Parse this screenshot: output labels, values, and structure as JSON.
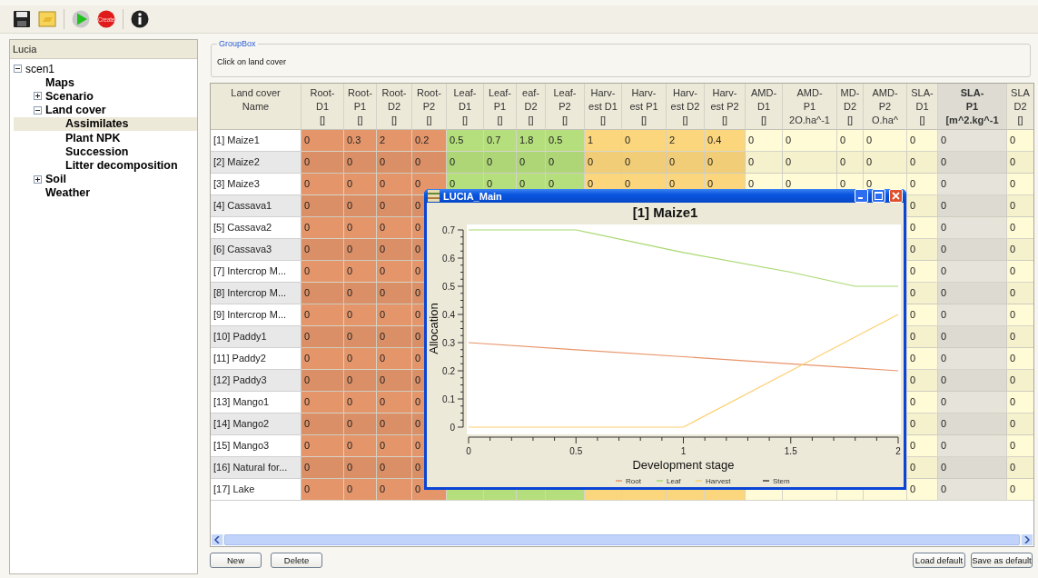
{
  "toolbar": {
    "buttons": [
      {
        "kind": "save"
      },
      {
        "kind": "open"
      },
      {
        "kind": "run"
      },
      {
        "kind": "stop",
        "label": "Create"
      },
      {
        "kind": "info"
      }
    ]
  },
  "tree": {
    "title": "Lucia",
    "items": [
      {
        "label": "scen1",
        "expanded": true,
        "selected": false,
        "children": [
          {
            "label": "Maps",
            "selected": false
          },
          {
            "label": "Scenario",
            "expanded": false,
            "selected": false
          },
          {
            "label": "Land cover",
            "expanded": true,
            "selected": false,
            "children": [
              {
                "label": "Assimilates",
                "selected": true
              },
              {
                "label": "Plant NPK",
                "selected": false
              },
              {
                "label": "Succession",
                "selected": false
              },
              {
                "label": "Litter decomposition",
                "selected": false
              }
            ]
          },
          {
            "label": "Soil",
            "expanded": false,
            "selected": false
          },
          {
            "label": "Weather",
            "selected": false
          }
        ]
      }
    ]
  },
  "groupbox": {
    "title": "GroupBox",
    "text": "Click on land cover"
  },
  "table": {
    "name_header": [
      "Land cover",
      "Name"
    ],
    "columns": [
      {
        "lines": [
          "Root-",
          "D1",
          "[]"
        ],
        "color": "#e4956a",
        "selected": false
      },
      {
        "lines": [
          "Root-",
          "P1",
          "[]"
        ],
        "color": "#e4956a",
        "selected": false
      },
      {
        "lines": [
          "Root-",
          "D2",
          "[]"
        ],
        "color": "#e4956a",
        "selected": false
      },
      {
        "lines": [
          "Root-",
          "P2",
          "[]"
        ],
        "color": "#e4956a",
        "selected": false
      },
      {
        "lines": [
          "Leaf-",
          "D1",
          "[]"
        ],
        "color": "#b5df7c",
        "selected": false
      },
      {
        "lines": [
          "Leaf-",
          "P1",
          "[]"
        ],
        "color": "#b5df7c",
        "selected": false
      },
      {
        "lines": [
          "eaf-",
          "D2",
          "[]"
        ],
        "color": "#b5df7c",
        "selected": false
      },
      {
        "lines": [
          "Leaf-",
          "P2",
          "[]"
        ],
        "color": "#b5df7c",
        "selected": false
      },
      {
        "lines": [
          "Harv-",
          "est D1",
          "[]"
        ],
        "color": "#fcd67c",
        "selected": false
      },
      {
        "lines": [
          "Harv-",
          "est P1",
          "[]"
        ],
        "color": "#fcd67c",
        "selected": false
      },
      {
        "lines": [
          "Harv-",
          "est D2",
          "[]"
        ],
        "color": "#fcd67c",
        "selected": false
      },
      {
        "lines": [
          "Harv-",
          "est P2",
          "[]"
        ],
        "color": "#fcd67c",
        "selected": false
      },
      {
        "lines": [
          "AMD-",
          "D1",
          "[]"
        ],
        "color": "#fffbd6",
        "selected": false
      },
      {
        "lines": [
          "AMD-",
          "P1",
          "2O.ha^-1"
        ],
        "color": "#fffbd6",
        "selected": false
      },
      {
        "lines": [
          "MD-",
          "D2",
          "[]"
        ],
        "color": "#fffbd6",
        "selected": false
      },
      {
        "lines": [
          "AMD-",
          "P2",
          "O.ha^"
        ],
        "color": "#fffbd6",
        "selected": false
      },
      {
        "lines": [
          "SLA-",
          "D1",
          "[]"
        ],
        "color": "#fffbd6",
        "selected": false
      },
      {
        "lines": [
          "SLA-",
          "P1",
          "[m^2.kg^-1"
        ],
        "color": "#e6e4da",
        "selected": true
      },
      {
        "lines": [
          "SLA",
          "D2",
          "[]"
        ],
        "color": "#fffbd6",
        "selected": false
      }
    ],
    "rows": [
      {
        "name": "[1] Maize1",
        "cells": [
          "0",
          "0.3",
          "2",
          "0.2",
          "0.5",
          "0.7",
          "1.8",
          "0.5",
          "1",
          "0",
          "2",
          "0.4",
          "0",
          "0",
          "0",
          "0",
          "0",
          "0",
          "0"
        ]
      },
      {
        "name": "[2] Maize2",
        "cells": [
          "0",
          "0",
          "0",
          "0",
          "0",
          "0",
          "0",
          "0",
          "0",
          "0",
          "0",
          "0",
          "0",
          "0",
          "0",
          "0",
          "0",
          "0",
          "0"
        ]
      },
      {
        "name": "[3] Maize3",
        "cells": [
          "0",
          "0",
          "0",
          "0",
          "0",
          "0",
          "0",
          "0",
          "0",
          "0",
          "0",
          "0",
          "0",
          "0",
          "0",
          "0",
          "0",
          "0",
          "0"
        ]
      },
      {
        "name": "[4] Cassava1",
        "cells": [
          "0",
          "0",
          "0",
          "0"
        ],
        "tail_cells": [
          "0",
          "0",
          "0"
        ]
      },
      {
        "name": "[5] Cassava2",
        "cells": [
          "0",
          "0",
          "0",
          "0"
        ],
        "tail_cells": [
          "0",
          "0",
          "0"
        ]
      },
      {
        "name": "[6] Cassava3",
        "cells": [
          "0",
          "0",
          "0",
          "0"
        ],
        "tail_cells": [
          "0",
          "0",
          "0"
        ]
      },
      {
        "name": "[7] Intercrop M...",
        "cells": [
          "0",
          "0",
          "0",
          "0"
        ],
        "tail_cells": [
          "0",
          "0",
          "0"
        ]
      },
      {
        "name": "[8] Intercrop M...",
        "cells": [
          "0",
          "0",
          "0",
          "0"
        ],
        "tail_cells": [
          "0",
          "0",
          "0"
        ]
      },
      {
        "name": "[9] Intercrop M...",
        "cells": [
          "0",
          "0",
          "0",
          "0"
        ],
        "tail_cells": [
          "0",
          "0",
          "0"
        ]
      },
      {
        "name": "[10] Paddy1",
        "cells": [
          "0",
          "0",
          "0",
          "0"
        ],
        "tail_cells": [
          "0",
          "0",
          "0"
        ]
      },
      {
        "name": "[11] Paddy2",
        "cells": [
          "0",
          "0",
          "0",
          "0"
        ],
        "tail_cells": [
          "0",
          "0",
          "0"
        ]
      },
      {
        "name": "[12] Paddy3",
        "cells": [
          "0",
          "0",
          "0",
          "0"
        ],
        "tail_cells": [
          "0",
          "0",
          "0"
        ]
      },
      {
        "name": "[13] Mango1",
        "cells": [
          "0",
          "0",
          "0",
          "0"
        ],
        "tail_cells": [
          "0",
          "0",
          "0"
        ]
      },
      {
        "name": "[14] Mango2",
        "cells": [
          "0",
          "0",
          "0",
          "0"
        ],
        "tail_cells": [
          "0",
          "0",
          "0"
        ]
      },
      {
        "name": "[15] Mango3",
        "cells": [
          "0",
          "0",
          "0",
          "0"
        ],
        "tail_cells": [
          "0",
          "0",
          "0"
        ]
      },
      {
        "name": "[16] Natural for...",
        "cells": [
          "0",
          "0",
          "0",
          "0"
        ],
        "tail_cells": [
          "0",
          "0",
          "0"
        ]
      },
      {
        "name": "[17] Lake",
        "cells": [
          "0",
          "0",
          "0",
          "0"
        ],
        "tail_cells": [
          "0",
          "0",
          "0"
        ]
      }
    ]
  },
  "chart_window": {
    "title": "LUCIA_Main",
    "chart_data": {
      "type": "line",
      "title": "[1] Maize1",
      "xlabel": "Development stage",
      "ylabel": "Allocation",
      "x": [
        0,
        0.5,
        1,
        1.5,
        1.8,
        2
      ],
      "series": [
        {
          "name": "Root",
          "color": "#e8946a",
          "values": [
            0.3,
            0.275,
            0.25,
            0.225,
            0.21,
            0.2
          ]
        },
        {
          "name": "Leaf",
          "color": "#a8d870",
          "values": [
            0.7,
            0.7,
            0.62,
            0.55,
            0.5,
            0.5
          ]
        },
        {
          "name": "Harvest",
          "color": "#fcd070",
          "values": [
            0,
            0,
            0,
            0.2,
            0.32,
            0.4
          ]
        },
        {
          "name": "Stem",
          "color": "#404040",
          "values": [
            null,
            null,
            null,
            null,
            null,
            null
          ]
        }
      ],
      "legend": "bottom",
      "xlim": [
        0,
        2
      ],
      "ylim": [
        0,
        0.7
      ],
      "xticks": [
        0,
        0.5,
        1,
        1.5,
        2
      ],
      "yticks": [
        0,
        0.1,
        0.2,
        0.3,
        0.4,
        0.5,
        0.6,
        0.7
      ]
    }
  },
  "bottom_buttons_left": [
    "New",
    "Delete"
  ],
  "bottom_buttons_right": [
    "Load default",
    "Save as default"
  ]
}
